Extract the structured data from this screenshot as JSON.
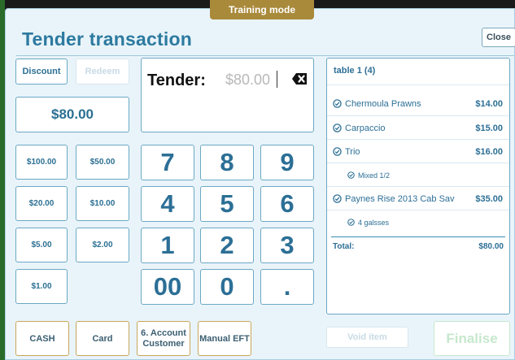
{
  "training_badge": "Training mode",
  "title": "Tender transaction",
  "close_label": "Close",
  "left_controls": {
    "discount": "Discount",
    "redeem": "Redeem",
    "amount_due": "$80.00"
  },
  "quick_amounts": [
    "$100.00",
    "$50.00",
    "$20.00",
    "$10.00",
    "$5.00",
    "$2.00",
    "$1.00"
  ],
  "tender_display": {
    "label": "Tender:",
    "value": "$80.00"
  },
  "keypad": [
    "7",
    "8",
    "9",
    "4",
    "5",
    "6",
    "1",
    "2",
    "3",
    "00",
    "0",
    "."
  ],
  "payment_methods": {
    "cash": "CASH",
    "card": "Card",
    "account_line1": "6. Account",
    "account_line2": "Customer",
    "manual_eft": "Manual EFT"
  },
  "order": {
    "title": "table 1 (4)",
    "items": [
      {
        "name": "Chermoula Prawns",
        "price": "$14.00"
      },
      {
        "name": "Carpaccio",
        "price": "$15.00"
      },
      {
        "name": "Trio",
        "price": "$16.00"
      },
      {
        "name": "Mixed 1/2",
        "price": ""
      },
      {
        "name": "Paynes Rise 2013 Cab Sav",
        "price": "$35.00"
      },
      {
        "name": "4 galsses",
        "price": ""
      }
    ],
    "total_label": "Total:",
    "total_value": "$80.00"
  },
  "void_item": "Void item",
  "finalise": "Finalise",
  "colors": {
    "accent": "#2d7aa0",
    "badge": "#a98a3b",
    "panel_bg": "#e9f4fa",
    "payment_border": "#c7a65a",
    "finalise_disabled": "#c6e8cc"
  }
}
